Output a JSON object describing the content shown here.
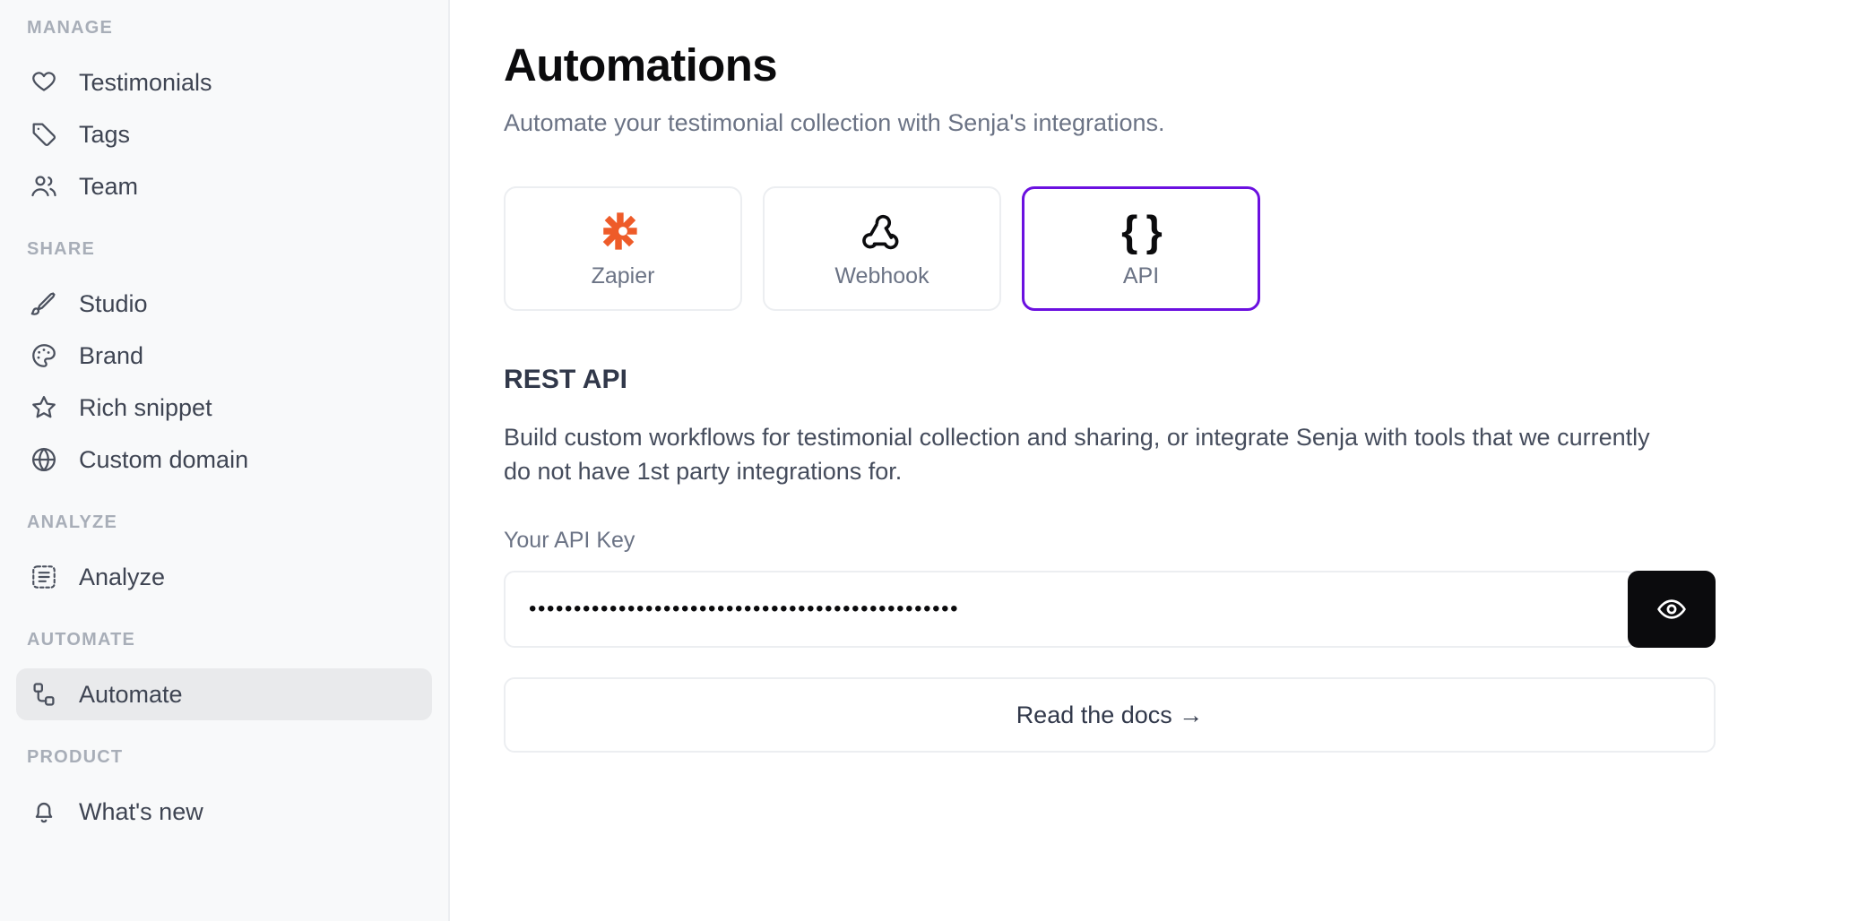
{
  "sidebar": {
    "groups": [
      {
        "label": "MANAGE",
        "items": [
          {
            "label": "Testimonials",
            "icon": "heart-icon",
            "active": false
          },
          {
            "label": "Tags",
            "icon": "tag-icon",
            "active": false
          },
          {
            "label": "Team",
            "icon": "users-icon",
            "active": false
          }
        ]
      },
      {
        "label": "SHARE",
        "items": [
          {
            "label": "Studio",
            "icon": "brush-icon",
            "active": false
          },
          {
            "label": "Brand",
            "icon": "palette-icon",
            "active": false
          },
          {
            "label": "Rich snippet",
            "icon": "star-icon",
            "active": false
          },
          {
            "label": "Custom domain",
            "icon": "globe-icon",
            "active": false
          }
        ]
      },
      {
        "label": "ANALYZE",
        "items": [
          {
            "label": "Analyze",
            "icon": "analyze-icon",
            "active": false
          }
        ]
      },
      {
        "label": "AUTOMATE",
        "items": [
          {
            "label": "Automate",
            "icon": "automate-nodes-icon",
            "active": true
          }
        ]
      },
      {
        "label": "PRODUCT",
        "items": [
          {
            "label": "What's new",
            "icon": "bell-icon",
            "active": false
          }
        ]
      }
    ]
  },
  "main": {
    "title": "Automations",
    "subtitle": "Automate your testimonial collection with Senja's integrations.",
    "cards": [
      {
        "label": "Zapier",
        "icon": "zapier-icon",
        "selected": false,
        "color": "#ee5b29"
      },
      {
        "label": "Webhook",
        "icon": "webhook-icon",
        "selected": false,
        "color": "#0b0b0d"
      },
      {
        "label": "API",
        "icon": "curly-braces-icon",
        "selected": true,
        "color": "#0b0b0d"
      }
    ],
    "rest_api": {
      "heading": "REST API",
      "description": "Build custom workflows for testimonial collection and sharing, or integrate Senja with tools that we currently do not have 1st party integrations for.",
      "api_key_label": "Your API Key",
      "api_key_masked": "••••••••••••••••••••••••••••••••••••••••••••••••",
      "reveal_icon": "eye-icon",
      "docs_button_label": "Read the docs →"
    }
  },
  "colors": {
    "accent_purple": "#6b10e0",
    "zapier_orange": "#ee5b29",
    "sidebar_bg": "#f8f9fa",
    "active_item_bg": "#e9eaec",
    "border": "#eceef1",
    "text_muted": "#6b7385",
    "text_dark": "#31384a",
    "button_black": "#0b0b0d"
  }
}
